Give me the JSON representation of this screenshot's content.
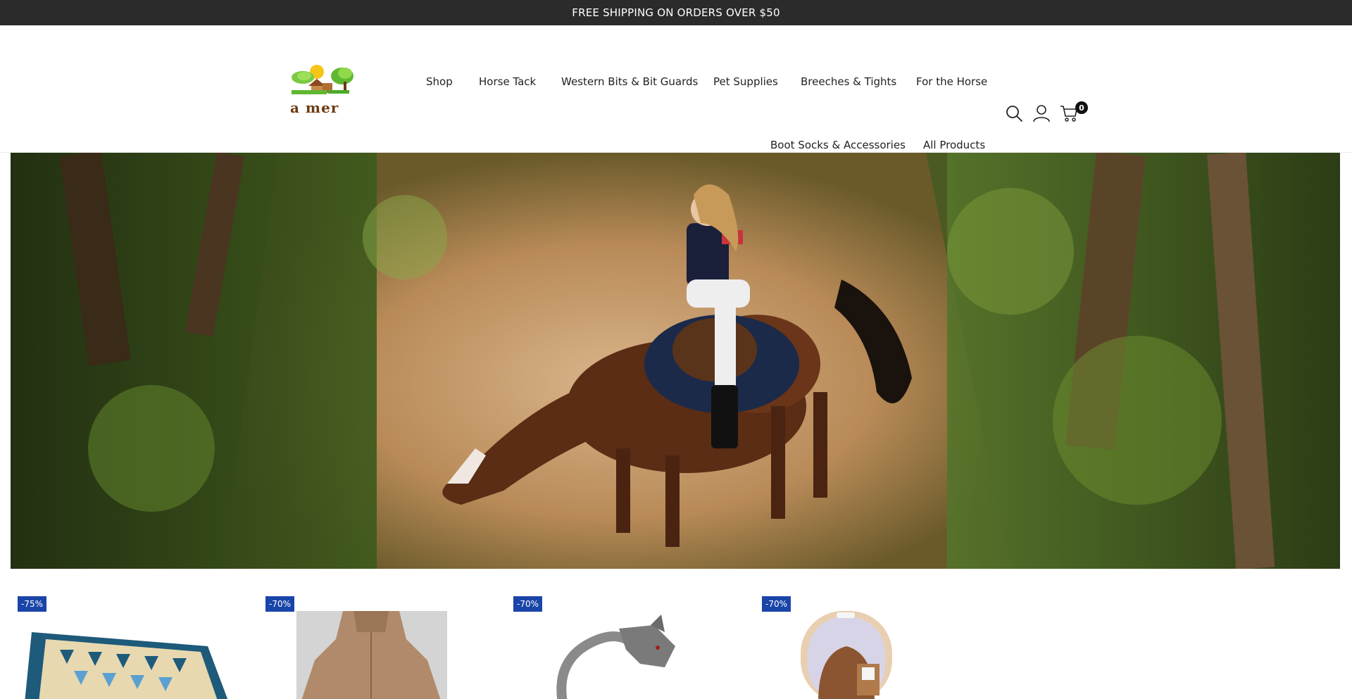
{
  "announcement": {
    "text": "FREE SHIPPING ON ORDERS OVER $50"
  },
  "brand": {
    "logo_text": "a mer"
  },
  "nav": {
    "items": [
      {
        "label": "Shop"
      },
      {
        "label": "Horse Tack"
      },
      {
        "label": "Western Bits & Bit Guards"
      },
      {
        "label": "Pet Supplies"
      },
      {
        "label": "Breeches & Tights"
      },
      {
        "label": "For the Horse"
      },
      {
        "label": "Boot Socks & Accessories"
      },
      {
        "label": "All Products"
      }
    ]
  },
  "header_icons": {
    "search": "search-icon",
    "account": "user-icon",
    "cart": "cart-icon",
    "cart_count": "0"
  },
  "hero": {
    "description_icon": "hero-image"
  },
  "products": [
    {
      "discount": "-75%"
    },
    {
      "discount": "-70%"
    },
    {
      "discount": "-70%"
    },
    {
      "discount": "-70%"
    }
  ],
  "colors": {
    "announcement_bg": "#2b2b2b",
    "badge_bg": "#1a45a8",
    "badge_text": "#ffffff"
  }
}
